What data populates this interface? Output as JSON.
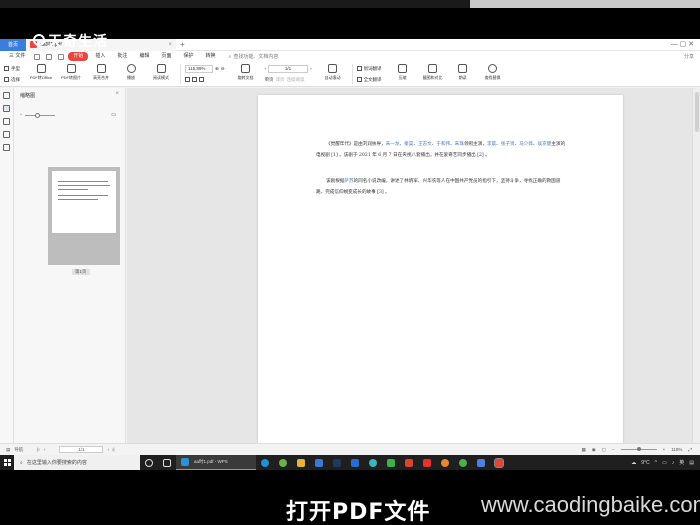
{
  "watermark": {
    "site_text": "天奇生活",
    "url": "www.caodingbaike.com"
  },
  "caption": "打开PDF文件",
  "tabs": {
    "home": "首页",
    "doc_title": "aa时1.pdf"
  },
  "menu": {
    "file": "三 文件",
    "items": [
      "开始",
      "插入",
      "批注",
      "编辑",
      "页面",
      "保护",
      "转换"
    ],
    "active_index": 0,
    "search": "查找功能、文档内容",
    "right": "分享"
  },
  "ribbon": {
    "hand": "手型",
    "select": "选择",
    "buttons": [
      {
        "label": "PDF转Office",
        "icon": "pdf-to-office-icon"
      },
      {
        "label": "PDF转图片",
        "icon": "pdf-to-image-icon"
      },
      {
        "label": "高亮合并",
        "icon": "merge-icon"
      },
      {
        "label": "播放",
        "icon": "play-icon"
      },
      {
        "label": "阅读模式",
        "icon": "read-mode-icon"
      }
    ],
    "zoom": "115.89%",
    "page_value": "1/1",
    "single_page": "单页",
    "double_page": "双页",
    "continuous": "连续阅读",
    "rotate": "旋转文档",
    "auto_scroll": "自动滚动",
    "right_buttons": [
      {
        "label": "全文翻译",
        "icon": "translate-icon"
      },
      {
        "label": "压缩",
        "icon": "compress-icon"
      },
      {
        "label": "截图和对比",
        "icon": "screenshot-icon"
      },
      {
        "label": "朗读",
        "icon": "read-aloud-icon"
      },
      {
        "label": "查找替换",
        "icon": "find-icon"
      }
    ],
    "translate_label": "划词翻译"
  },
  "thumbnail_panel": {
    "title": "缩略图",
    "page_label": "第1页"
  },
  "document": {
    "para1": [
      {
        "t": "《觉醒年代》是由刘润执导，"
      },
      {
        "t": "朱一龙",
        "link": true
      },
      {
        "t": "、"
      },
      {
        "t": "秦昊",
        "link": true
      },
      {
        "t": "、"
      },
      {
        "t": "王志文",
        "link": true
      },
      {
        "t": "、"
      },
      {
        "t": "于和伟",
        "link": true
      },
      {
        "t": "、"
      },
      {
        "t": "朱珠",
        "link": true
      },
      {
        "t": "领衔主演，"
      },
      {
        "t": "李晨",
        "link": true
      },
      {
        "t": "、"
      },
      {
        "t": "张子贤",
        "link": true
      },
      {
        "t": "、"
      },
      {
        "t": "马少骅",
        "link": true
      },
      {
        "t": "、"
      },
      {
        "t": "侯京健",
        "link": true
      },
      {
        "t": "主演的电视剧 [1] 。该剧于 2021 年 6 月 7 日在央视八套播出，并在爱奇艺同步播出 [2] 。"
      }
    ],
    "para2": [
      {
        "t": "该剧根据"
      },
      {
        "t": "萨苏",
        "link": true
      },
      {
        "t": "的同名小说改编，讲述了林炳军、兴华农等人在中国共产党员的指引下，坚持斗争，寻找正确的救国道路，完成信仰蜕变成长的故事 [3] 。"
      }
    ]
  },
  "status": {
    "nav_label": "导航",
    "page": "1/1",
    "zoom": "118%"
  },
  "taskbar": {
    "search_placeholder": "在这里输入你要搜索的内容",
    "active_app": "aa时1.pdf - WPS",
    "weather": "9°C",
    "time": "",
    "tray_lang": "英"
  },
  "colors": {
    "accent_red": "#e8453c",
    "home_tab": "#3b7ddd",
    "link_blue": "#4a78c8"
  }
}
